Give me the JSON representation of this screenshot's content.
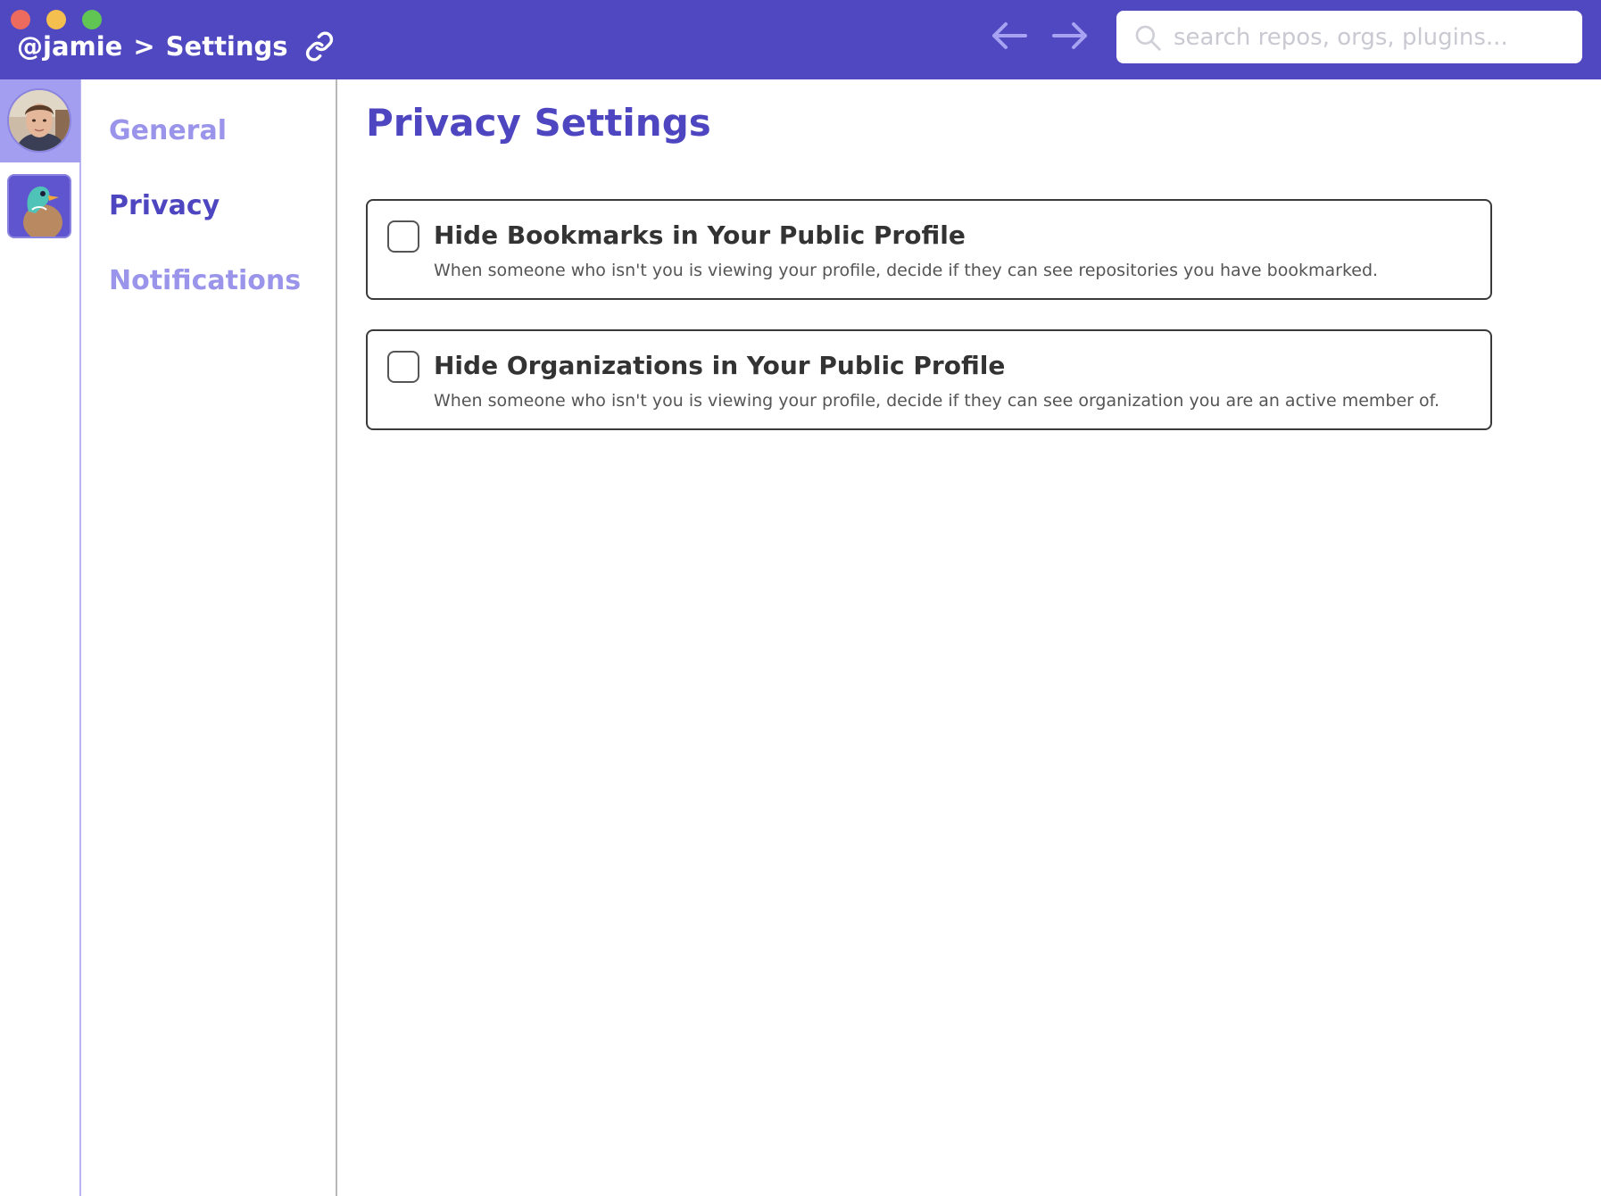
{
  "window": {
    "traffic_lights": [
      "close",
      "minimize",
      "maximize"
    ]
  },
  "header": {
    "breadcrumb_user": "@jamie",
    "breadcrumb_separator": ">",
    "breadcrumb_page": "Settings",
    "link_icon": "link-icon",
    "back_icon": "arrow-left-icon",
    "forward_icon": "arrow-right-icon",
    "search": {
      "placeholder": "search repos, orgs, plugins...",
      "value": "",
      "icon": "search-icon"
    }
  },
  "rail": {
    "items": [
      {
        "name": "user-avatar",
        "active": true
      },
      {
        "name": "duck-org-logo",
        "active": false
      }
    ]
  },
  "settings_nav": {
    "items": [
      {
        "label": "General",
        "active": false
      },
      {
        "label": "Privacy",
        "active": true
      },
      {
        "label": "Notifications",
        "active": false
      }
    ]
  },
  "main": {
    "title": "Privacy Settings",
    "options": [
      {
        "title": "Hide Bookmarks in Your Public Profile",
        "description": "When someone who isn't you is viewing your profile, decide if they can see repositories you have bookmarked.",
        "checked": false
      },
      {
        "title": "Hide Organizations in Your Public Profile",
        "description": "When someone who isn't you is viewing your profile, decide if they can see organization you are an active member of.",
        "checked": false
      }
    ]
  },
  "colors": {
    "brand": "#5048c0",
    "accent_active": "#4e46c0",
    "accent_inactive": "#9a94ea",
    "rail_active": "#a49ef0"
  }
}
